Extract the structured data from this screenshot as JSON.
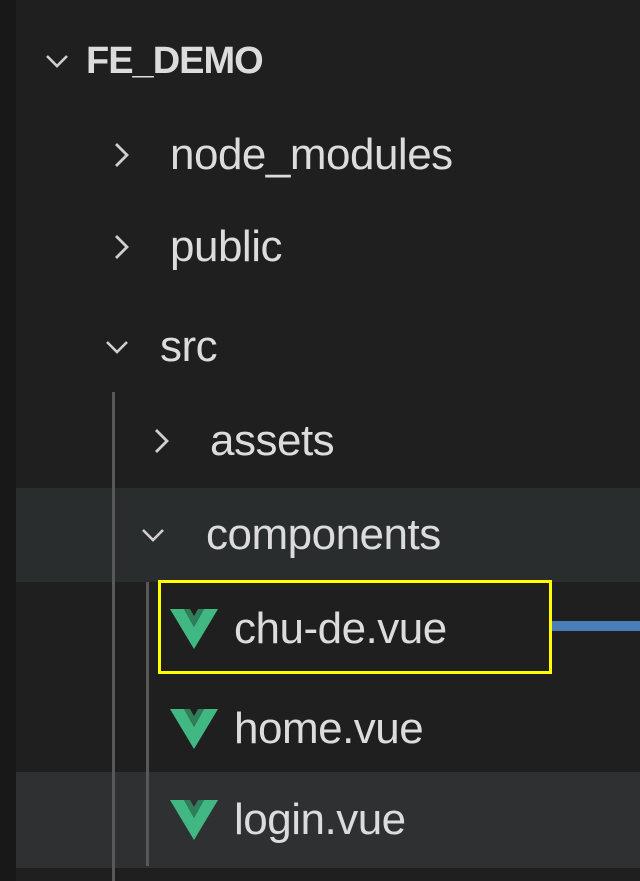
{
  "explorer": {
    "root": {
      "label": "FE_DEMO",
      "expanded": true,
      "icon": "chevron-down-icon"
    },
    "items": [
      {
        "label": "node_modules",
        "type": "folder",
        "expanded": false,
        "icon": "chevron-right-icon"
      },
      {
        "label": "public",
        "type": "folder",
        "expanded": false,
        "icon": "chevron-right-icon"
      },
      {
        "label": "src",
        "type": "folder",
        "expanded": true,
        "icon": "chevron-down-icon"
      },
      {
        "label": "assets",
        "type": "folder",
        "expanded": false,
        "icon": "chevron-right-icon"
      },
      {
        "label": "components",
        "type": "folder",
        "expanded": true,
        "icon": "chevron-down-icon"
      },
      {
        "label": "chu-de.vue",
        "type": "file",
        "icon": "vue-file-icon",
        "highlighted": true
      },
      {
        "label": "home.vue",
        "type": "file",
        "icon": "vue-file-icon"
      },
      {
        "label": "login.vue",
        "type": "file",
        "icon": "vue-file-icon"
      }
    ]
  },
  "colors": {
    "background": "#1f1f1f",
    "row_hover": "#2a2d2e",
    "text": "#dcdcdc",
    "vue_green": "#41b883",
    "highlight_border": "#ffff00",
    "arrow": "#4a7eb8"
  }
}
